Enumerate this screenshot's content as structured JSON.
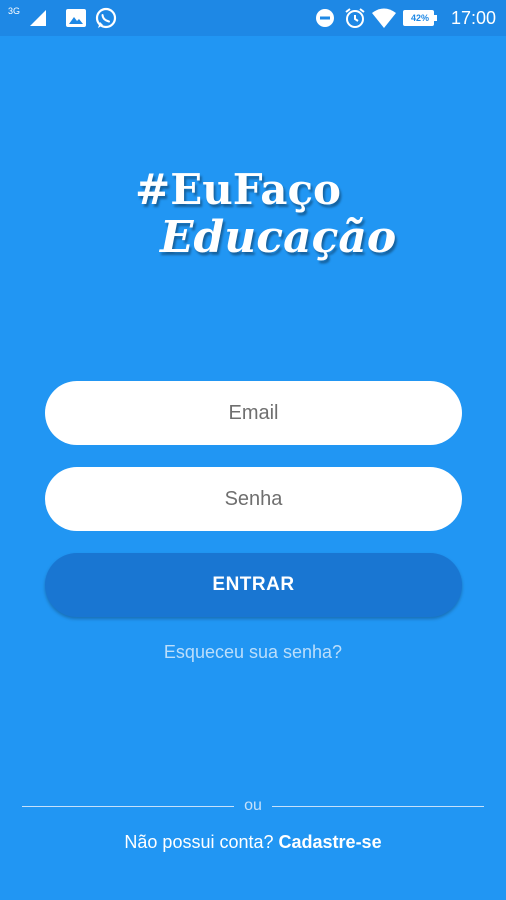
{
  "status_bar": {
    "network_type": "3G",
    "battery_percent": "42%",
    "time": "17:00",
    "icons": [
      "signal-icon",
      "image-icon",
      "whatsapp-icon",
      "dnd-icon",
      "alarm-icon",
      "wifi-icon",
      "battery-icon"
    ]
  },
  "logo": {
    "line1": "#EuFaço",
    "line2": "Educação"
  },
  "form": {
    "email_placeholder": "Email",
    "password_placeholder": "Senha",
    "submit_label": "ENTRAR",
    "forgot_label": "Esqueceu sua senha?"
  },
  "footer": {
    "divider_text": "ou",
    "signup_prompt": "Não possui conta?",
    "signup_link": "Cadastre-se"
  },
  "colors": {
    "background": "#2196f3",
    "status_bar": "#1e88e5",
    "button": "#1976d2",
    "input": "#ffffff"
  }
}
